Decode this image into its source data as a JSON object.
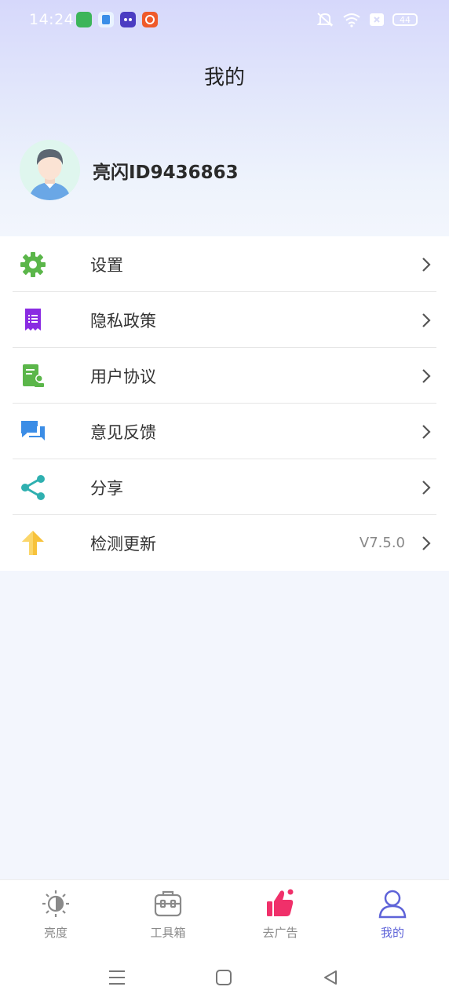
{
  "status_bar": {
    "time": "14:24",
    "battery": "44",
    "icons": [
      "app-notification-icon-green",
      "app-notification-icon-blue",
      "app-notification-icon-purple",
      "app-notification-icon-orange",
      "mute-icon",
      "wifi-icon",
      "sim-off-icon",
      "battery-icon"
    ]
  },
  "header": {
    "title": "我的"
  },
  "profile": {
    "username": "亮闪ID9436863",
    "avatar_icon": "user-avatar"
  },
  "menu": [
    {
      "label": "设置",
      "icon": "gear-icon",
      "color": "#5bb64a"
    },
    {
      "label": "隐私政策",
      "icon": "document-list-icon",
      "color": "#8a2be2"
    },
    {
      "label": "用户协议",
      "icon": "agreement-icon",
      "color": "#5bb64a"
    },
    {
      "label": "意见反馈",
      "icon": "chat-icon",
      "color": "#3b8de6"
    },
    {
      "label": "分享",
      "icon": "share-icon",
      "color": "#2fb0b0"
    },
    {
      "label": "检测更新",
      "icon": "upload-arrow-icon",
      "color": "#f7c23b",
      "value": "V7.5.0"
    }
  ],
  "tabs": [
    {
      "label": "亮度",
      "icon": "brightness-icon",
      "active": false
    },
    {
      "label": "工具箱",
      "icon": "toolbox-icon",
      "active": false
    },
    {
      "label": "去广告",
      "icon": "thumbs-up-icon",
      "active": false
    },
    {
      "label": "我的",
      "icon": "person-icon",
      "active": true
    }
  ],
  "colors": {
    "accent": "#5e63d8",
    "ad_tab": "#f0306a"
  },
  "system_nav": [
    "menu-icon",
    "home-icon",
    "back-icon"
  ]
}
